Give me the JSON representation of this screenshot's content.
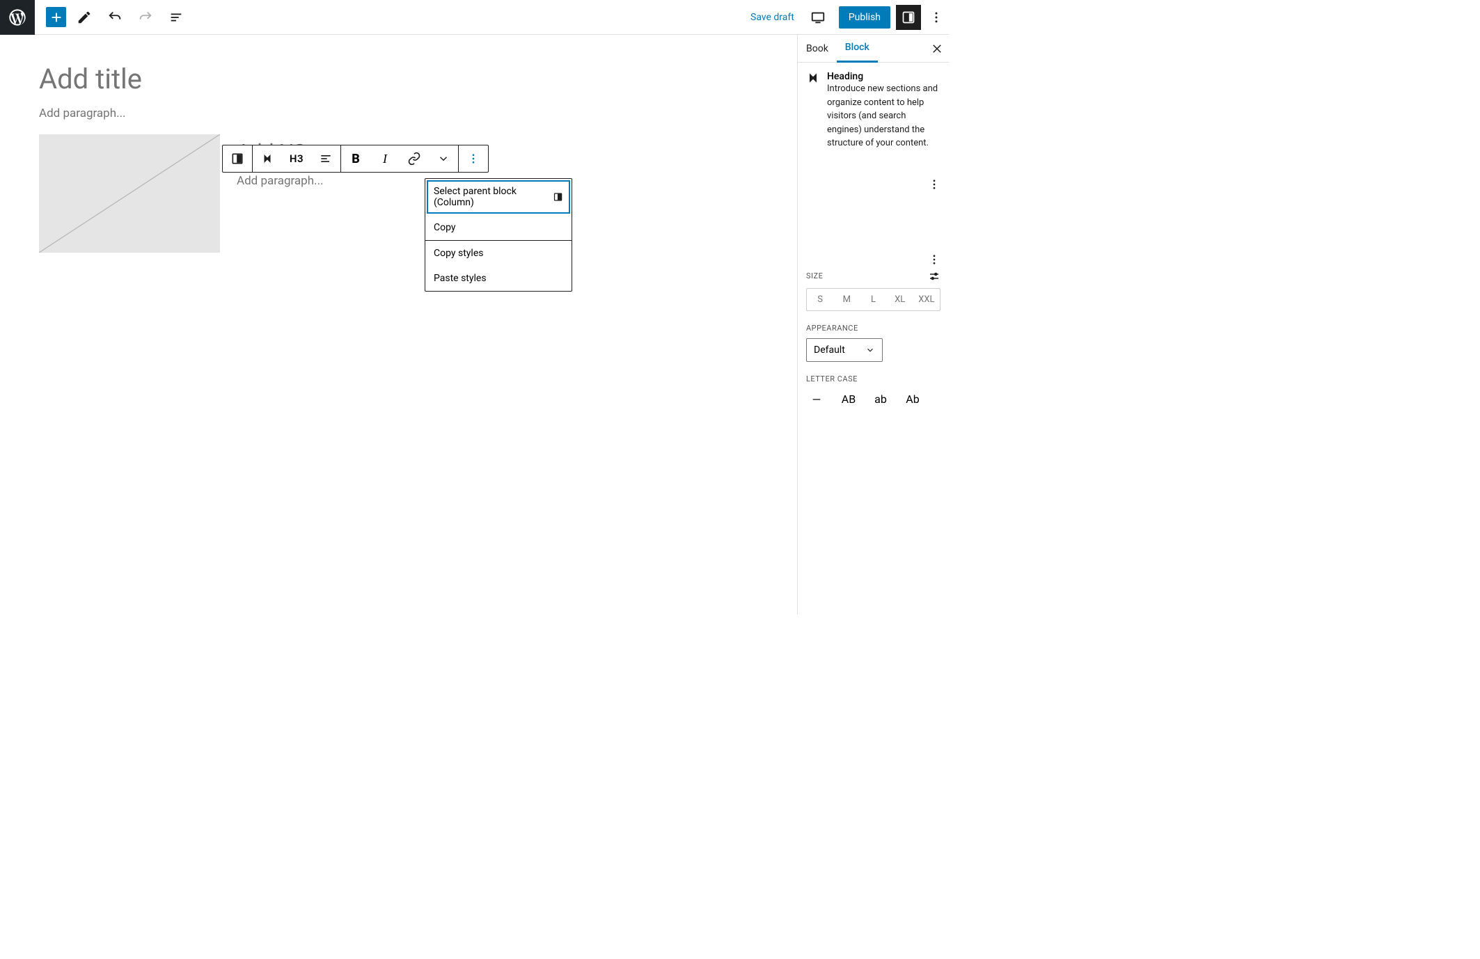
{
  "toolbar": {
    "save_draft": "Save draft",
    "publish": "Publish"
  },
  "editor": {
    "title_placeholder": "Add title",
    "para_placeholder": "Add paragraph...",
    "h3_placeholder": "Add H3...",
    "col_para_placeholder": "Add paragraph..."
  },
  "block_toolbar": {
    "heading_level": "H3"
  },
  "context_menu": {
    "select_parent": "Select parent block (Column)",
    "copy": "Copy",
    "copy_styles": "Copy styles",
    "paste_styles": "Paste styles"
  },
  "sidebar": {
    "tabs": {
      "book": "Book",
      "block": "Block"
    },
    "block_name": "Heading",
    "block_desc": "Introduce new sections and organize content to help visitors (and search engines) understand the structure of your content.",
    "size_label": "SIZE",
    "sizes": [
      "S",
      "M",
      "L",
      "XL",
      "XXL"
    ],
    "appearance_label": "APPEARANCE",
    "appearance_value": "Default",
    "letter_case_label": "LETTER CASE",
    "letter_case": [
      "AB",
      "ab",
      "Ab"
    ]
  }
}
